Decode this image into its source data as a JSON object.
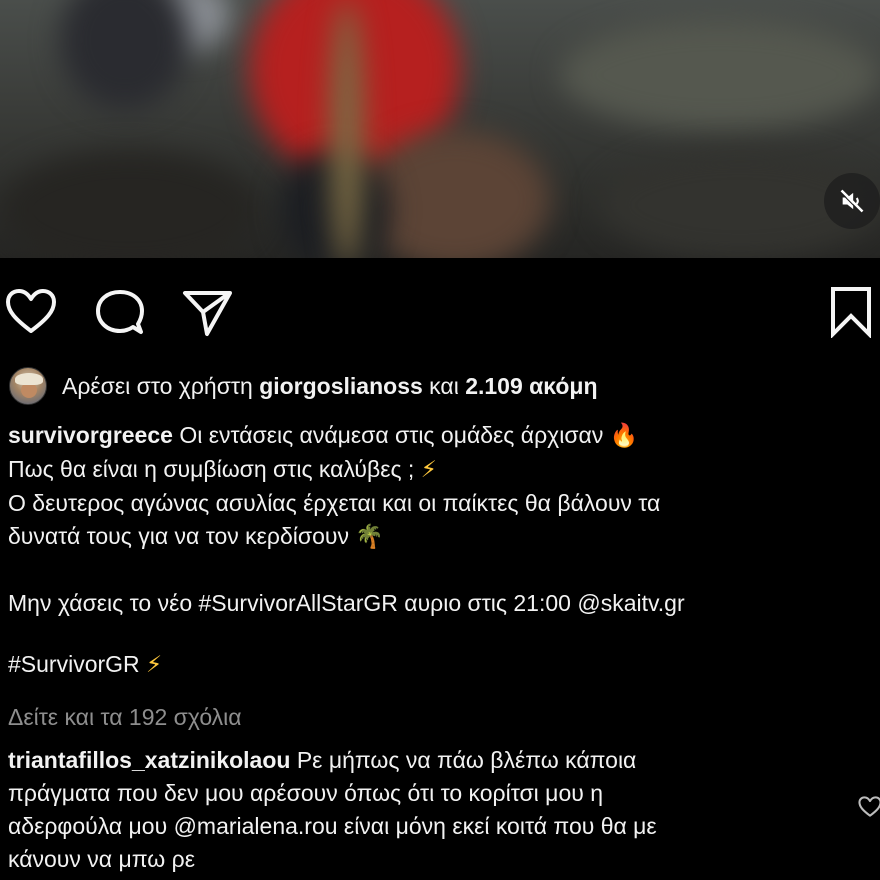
{
  "video": {
    "mute_icon": "speaker-muted-icon"
  },
  "actions": {
    "like_icon": "heart-icon",
    "comment_icon": "comment-bubble-icon",
    "share_icon": "paper-plane-icon",
    "save_icon": "bookmark-icon"
  },
  "likes": {
    "prefix": "Αρέσει στο χρήστη",
    "username": "giorgoslianoss",
    "middle": "και",
    "count": "2.109 ακόμη"
  },
  "caption": {
    "username": "survivorgreece",
    "line1": "Οι εντάσεις ανάμεσα στις ομάδες άρχισαν",
    "line1_emoji": "🔥",
    "line2": "Πως θα είναι η συμβίωση στις καλύβες ;",
    "line2_emoji": "⚡",
    "line3": "Ο δευτερος αγώνας ασυλίας έρχεται και οι παίκτες θα βάλουν τα",
    "line4": "δυνατά τους για να τον κερδίσουν",
    "line4_emoji": "🌴",
    "line5": "Μην χάσεις το νέο #SurvivorAllStarGR αυριο στις 21:00 @skaitv.gr",
    "line6": "#SurvivorGR",
    "line6_emoji": "⚡"
  },
  "view_comments": "Δείτε και τα 192 σχόλια",
  "comment": {
    "username": "triantafillos_xatzinikolaou",
    "line1": "Ρε μήπως να πάω βλέπω κάποια",
    "line2": "πράγματα που δεν μου αρέσουν όπως ότι το κορίτσι μου η",
    "line3": "αδερφούλα μου @marialena.rou είναι μόνη εκεί κοιτά που θα με",
    "line4": "κάνουν να μπω ρε",
    "like_icon": "heart-outline-icon"
  }
}
